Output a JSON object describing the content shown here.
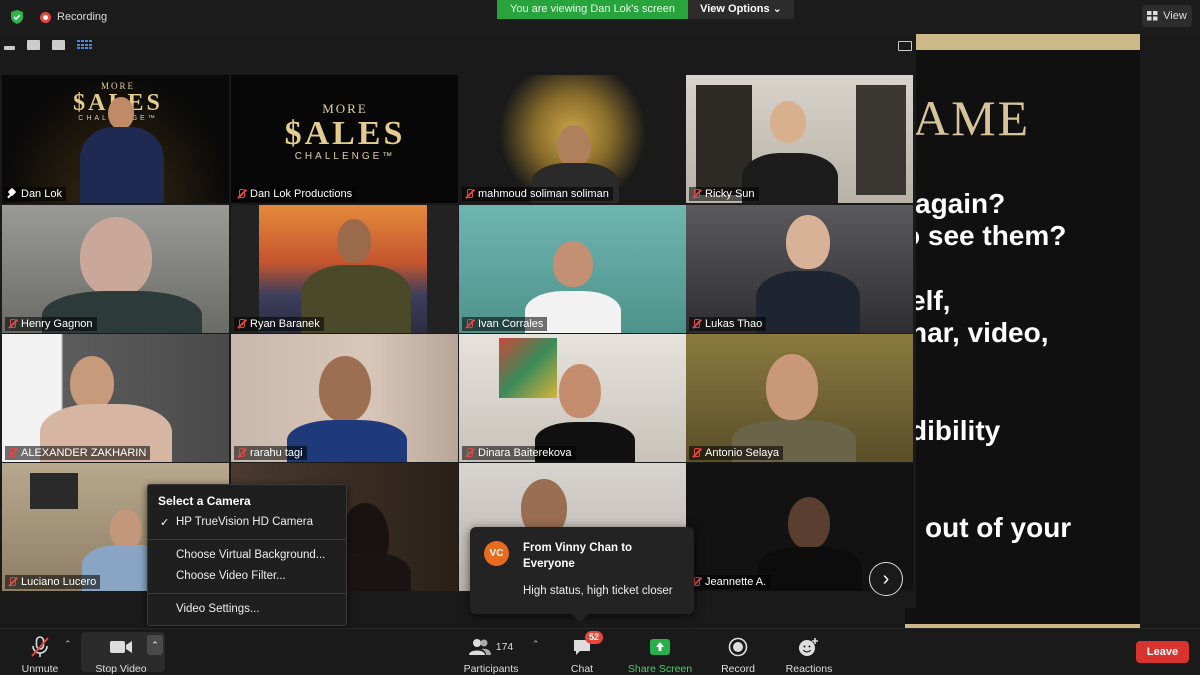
{
  "top_bar": {
    "recording_label": "Recording",
    "share_banner": "You are viewing Dan Lok's screen",
    "view_options_label": "View Options",
    "view_label": "View"
  },
  "shared_screen": {
    "title_fragment": "AME",
    "lines": [
      "again?",
      "o see them?",
      "elf,",
      "nar, video,",
      "dibility",
      "out of your"
    ]
  },
  "logo_text": {
    "more": "MORE",
    "sales": "$ALES",
    "challenge": "CHALLENGE™"
  },
  "participants": [
    {
      "name": "Dan Lok",
      "muted": false,
      "pinned": true
    },
    {
      "name": "Dan Lok Productions",
      "muted": true
    },
    {
      "name": "mahmoud soliman soliman",
      "muted": true
    },
    {
      "name": "Ricky Sun",
      "muted": true
    },
    {
      "name": "Henry Gagnon",
      "muted": true
    },
    {
      "name": "Ryan Baranek",
      "muted": true
    },
    {
      "name": "Ivan Corrales",
      "muted": true
    },
    {
      "name": "Lukas Thao",
      "muted": true
    },
    {
      "name": "ALEXANDER ZAKHARIN",
      "muted": true
    },
    {
      "name": "rarahu tagi",
      "muted": true
    },
    {
      "name": "Dinara Baiterekova",
      "muted": true
    },
    {
      "name": "Antonio Selaya",
      "muted": true
    },
    {
      "name": "Luciano Lucero",
      "muted": true
    },
    {
      "name": "",
      "muted": true
    },
    {
      "name": "",
      "muted": true
    },
    {
      "name": "Jeannette A.",
      "muted": true
    }
  ],
  "camera_menu": {
    "header": "Select a Camera",
    "selected_camera": "HP TrueVision HD Camera",
    "items": [
      "Choose Virtual Background...",
      "Choose Video Filter..."
    ],
    "settings": "Video Settings..."
  },
  "chat_notification": {
    "avatar_initials": "VC",
    "from": "From Vinny Chan to Everyone",
    "message": "High status, high ticket closer"
  },
  "toolbar": {
    "unmute": "Unmute",
    "stop_video": "Stop Video",
    "participants": "Participants",
    "participants_count": "174",
    "chat": "Chat",
    "chat_badge": "52",
    "share_screen": "Share Screen",
    "record": "Record",
    "reactions": "Reactions",
    "leave": "Leave"
  },
  "colors": {
    "share_green": "#27a53c",
    "active_speaker": "#d6d85f",
    "leave_red": "#d8332f",
    "gold": "#cdb887"
  }
}
